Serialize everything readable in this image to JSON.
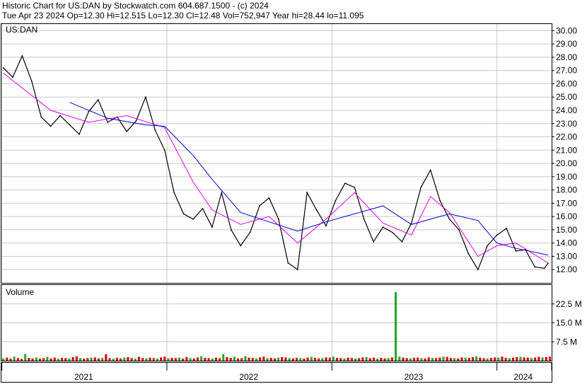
{
  "header": {
    "line1": "Historic Chart for US:DAN by Stockwatch.com 604.687.1500 - (c) 2024",
    "line2": "Tue Apr 23 2024   Op=12.30   Hi=12.515   Lo=12.30   Cl=12.48   Vol=752,947   Year hi=28.44   lo=11.095"
  },
  "colors": {
    "price": "#000000",
    "ma_short": "#e000e0",
    "ma_long": "#0000cc",
    "volume_up": "#22aa22",
    "volume_down": "#dd0000",
    "grid": "#c8c8c8"
  },
  "chart_data": [
    {
      "type": "line",
      "title": "US:DAN",
      "ylim": [
        11,
        30.5
      ],
      "y_ticks": [
        "30.00",
        "29.00",
        "28.00",
        "27.00",
        "26.00",
        "25.00",
        "24.00",
        "23.00",
        "22.00",
        "21.00",
        "20.00",
        "19.00",
        "18.00",
        "17.00",
        "16.00",
        "15.00",
        "14.00",
        "13.00",
        "12.00"
      ],
      "x_ticks": [
        "2021",
        "2022",
        "2023",
        "2024"
      ],
      "grid": true,
      "series": [
        {
          "kind": "price",
          "x": [
            "2021-01-04",
            "2021-01-25",
            "2021-02-15",
            "2021-03-08",
            "2021-03-29",
            "2021-04-19",
            "2021-05-10",
            "2021-05-31",
            "2021-06-21",
            "2021-07-12",
            "2021-08-02",
            "2021-08-23",
            "2021-09-13",
            "2021-10-04",
            "2021-10-25",
            "2021-11-15",
            "2021-12-06",
            "2021-12-27",
            "2022-01-17",
            "2022-02-07",
            "2022-02-28",
            "2022-03-21",
            "2022-04-11",
            "2022-05-02",
            "2022-05-23",
            "2022-06-13",
            "2022-07-04",
            "2022-07-25",
            "2022-08-15",
            "2022-09-05",
            "2022-09-26",
            "2022-10-17",
            "2022-11-07",
            "2022-11-28",
            "2022-12-19",
            "2023-01-09",
            "2023-01-30",
            "2023-02-20",
            "2023-03-13",
            "2023-04-03",
            "2023-04-24",
            "2023-05-15",
            "2023-06-05",
            "2023-06-26",
            "2023-07-17",
            "2023-08-07",
            "2023-08-28",
            "2023-09-18",
            "2023-10-09",
            "2023-10-30",
            "2023-11-20",
            "2023-12-11",
            "2024-01-01",
            "2024-01-22",
            "2024-02-12",
            "2024-03-04",
            "2024-03-25",
            "2024-04-15",
            "2024-04-23"
          ],
          "y": [
            27.2,
            26.5,
            28.1,
            26.2,
            23.5,
            22.8,
            23.6,
            22.9,
            22.2,
            23.9,
            24.8,
            23.1,
            23.5,
            22.4,
            23.2,
            25.0,
            22.5,
            21.0,
            17.8,
            16.2,
            15.8,
            16.6,
            15.2,
            17.8,
            15.0,
            13.8,
            14.8,
            16.8,
            17.4,
            15.8,
            12.5,
            12.0,
            17.8,
            16.5,
            15.3,
            17.2,
            18.5,
            18.2,
            15.8,
            14.1,
            15.2,
            14.8,
            14.1,
            15.5,
            18.2,
            19.5,
            17.2,
            15.8,
            15.0,
            13.2,
            12.0,
            13.8,
            14.6,
            15.1,
            13.4,
            13.5,
            12.2,
            12.1,
            12.48
          ]
        },
        {
          "kind": "moving_average_short",
          "x": [
            "2021-01-04",
            "2021-04-19",
            "2021-07-12",
            "2021-10-04",
            "2021-12-27",
            "2022-02-28",
            "2022-04-11",
            "2022-06-13",
            "2022-08-15",
            "2022-10-17",
            "2022-12-19",
            "2023-02-20",
            "2023-04-24",
            "2023-06-26",
            "2023-08-07",
            "2023-09-18",
            "2023-11-20",
            "2024-01-01",
            "2024-02-12",
            "2024-04-23"
          ],
          "y": [
            26.8,
            24.0,
            23.1,
            23.6,
            22.7,
            18.6,
            16.5,
            15.4,
            16.0,
            14.0,
            15.8,
            17.8,
            15.5,
            14.6,
            17.5,
            16.3,
            13.0,
            13.8,
            14.0,
            12.5
          ]
        },
        {
          "kind": "moving_average_long",
          "x": [
            "2021-05-31",
            "2021-08-23",
            "2021-11-15",
            "2021-12-27",
            "2022-02-28",
            "2022-04-11",
            "2022-06-13",
            "2022-08-15",
            "2022-10-17",
            "2022-12-19",
            "2023-02-20",
            "2023-04-24",
            "2023-06-26",
            "2023-08-07",
            "2023-09-18",
            "2023-11-20",
            "2024-01-01",
            "2024-02-12",
            "2024-04-23"
          ],
          "y": [
            24.6,
            23.4,
            22.9,
            22.8,
            20.6,
            18.8,
            16.3,
            15.6,
            14.9,
            15.6,
            16.2,
            16.8,
            15.4,
            15.8,
            16.2,
            15.7,
            14.0,
            13.6,
            13.1
          ]
        }
      ]
    },
    {
      "type": "bar",
      "title": "Volume",
      "ylim": [
        0,
        30
      ],
      "y_ticks": [
        "22.5 M",
        "15.0 M",
        "7.5 M"
      ],
      "unit": "M",
      "values": [
        0.9,
        1.2,
        0.8,
        1.6,
        1.0,
        0.7,
        2.6,
        1.1,
        0.9,
        1.3,
        0.8,
        1.0,
        1.5,
        0.9,
        1.2,
        0.8,
        1.1,
        1.0,
        0.9,
        1.4,
        1.7,
        1.1,
        0.8,
        1.0,
        1.2,
        1.3,
        0.9,
        1.1,
        2.5,
        1.0,
        0.8,
        1.1,
        0.9,
        1.2,
        1.4,
        1.0,
        0.8,
        1.5,
        1.1,
        0.9,
        1.2,
        1.0,
        0.8,
        1.3,
        1.6,
        0.9,
        1.1,
        1.0,
        1.2,
        0.8,
        1.4,
        1.0,
        0.9,
        1.3,
        1.8,
        1.1,
        1.0,
        0.9,
        1.2,
        1.0,
        2.6,
        1.4,
        1.1,
        1.6,
        0.9,
        1.0,
        1.8,
        1.2,
        1.1,
        0.9,
        1.3,
        1.6,
        1.0,
        1.1,
        0.9,
        1.2,
        1.4,
        1.3,
        1.0,
        0.9,
        1.1,
        1.0,
        0.8,
        1.2,
        1.5,
        1.1,
        0.9,
        1.0,
        1.3,
        1.2,
        1.6,
        1.1,
        1.0,
        0.9,
        1.2,
        1.1,
        0.9,
        1.0,
        1.3,
        1.4,
        1.0,
        1.2,
        0.8,
        1.1,
        0.9,
        1.0,
        1.3,
        27.2,
        1.6,
        1.2,
        1.0,
        0.9,
        1.1,
        1.2,
        1.0,
        0.9,
        1.3,
        1.1,
        1.0,
        1.2,
        1.6,
        1.5,
        1.1,
        1.0,
        0.9,
        1.3,
        1.2,
        1.1,
        1.4,
        1.7,
        1.2,
        1.0,
        0.9,
        1.1,
        1.3,
        1.2,
        1.6,
        1.1,
        1.0,
        1.2,
        1.4,
        1.5,
        1.3,
        1.2,
        1.1,
        1.2,
        1.5,
        1.3,
        1.4,
        1.6
      ]
    }
  ]
}
